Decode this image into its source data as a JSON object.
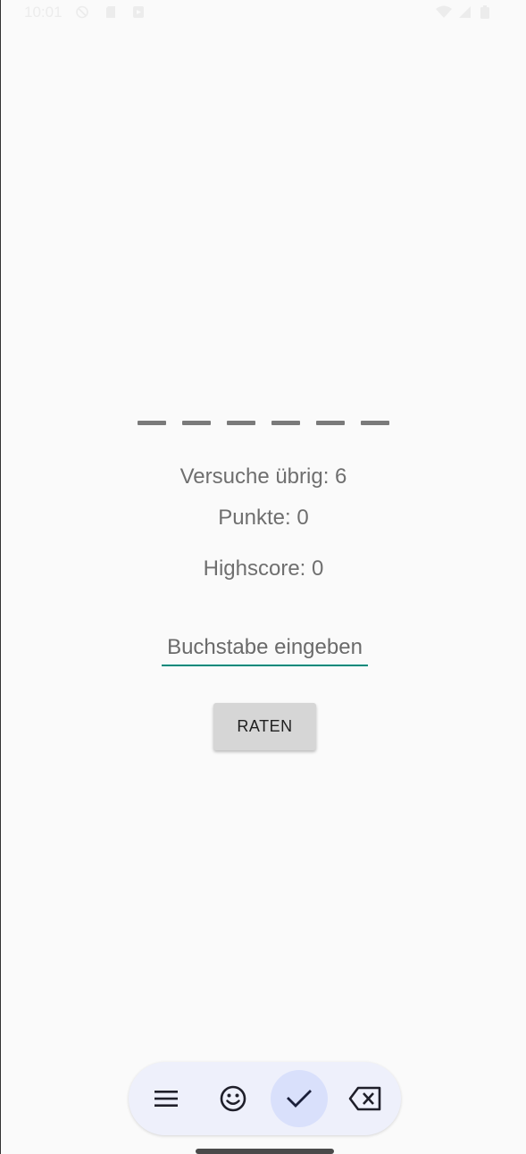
{
  "status_bar": {
    "time": "10:01",
    "left_icons": [
      "do-not-disturb-icon",
      "sd-card-icon",
      "media-icon"
    ],
    "right_icons": [
      "wifi-icon",
      "signal-icon",
      "battery-icon"
    ]
  },
  "game": {
    "word_blanks": 6,
    "tries_remaining": "Versuche übrig: 6",
    "points": "Punkte: 0",
    "highscore": "Highscore: 0"
  },
  "input": {
    "placeholder": "Buchstabe eingeben",
    "value": ""
  },
  "buttons": {
    "guess_label": "RATEN"
  },
  "keyboard_toolbar": {
    "items": [
      "menu-icon",
      "emoji-icon",
      "check-icon",
      "backspace-icon"
    ],
    "active_item": "check-icon"
  },
  "colors": {
    "accent": "#00897b",
    "button_bg": "#d6d6d6",
    "toolbar_bg": "#eef0fb",
    "toolbar_active": "#d9e0fb"
  }
}
